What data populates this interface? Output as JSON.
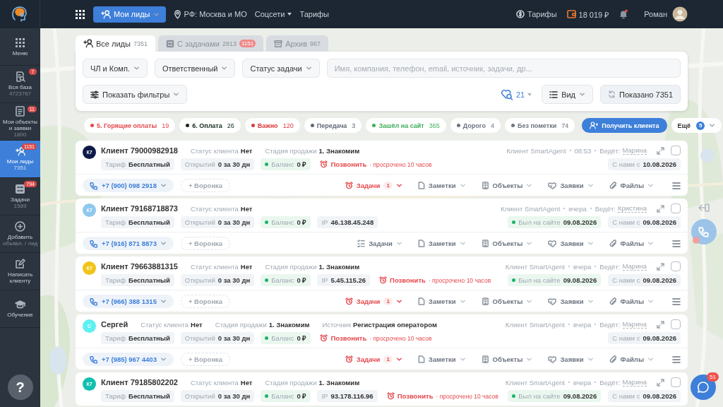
{
  "topbar": {
    "menu_button": {
      "label": "Мои лиды"
    },
    "region": "РФ: Москва и МО",
    "links": [
      {
        "label": "Соцсети",
        "dropdown": true
      },
      {
        "label": "Тарифы",
        "dropdown": false
      }
    ],
    "tariffs": "Тарифы",
    "balance": "18 019 ₽",
    "notifications_unread": true,
    "user": "Роман"
  },
  "sidebar": {
    "items": [
      {
        "kind": "menu",
        "label": "Меню",
        "selected": false
      },
      {
        "kind": "base",
        "label": "Вся база",
        "count": "4723767",
        "badge": "7",
        "selected": false
      },
      {
        "kind": "objects",
        "label": "Мои объекты и заявки",
        "count": "1800",
        "badge": "11",
        "selected": false
      },
      {
        "kind": "leads",
        "label": "Мои лиды",
        "count": "7351",
        "badge": "1151",
        "selected": true
      },
      {
        "kind": "tasks",
        "label": "Задачи",
        "count": "1589",
        "badge": "794",
        "selected": false
      },
      {
        "kind": "add",
        "label": "Добавить",
        "count": "объявл. / лид",
        "selected": false
      },
      {
        "kind": "write",
        "label": "Написать клиенту",
        "selected": false
      },
      {
        "kind": "learn",
        "label": "Обучение",
        "selected": false
      }
    ],
    "help_button": {
      "label": "?"
    }
  },
  "tabs": [
    {
      "kind": "all",
      "label": "Все лиды",
      "count": "7351",
      "selected": true
    },
    {
      "kind": "tasks",
      "label": "С задачами",
      "count": "2813",
      "badge": "1151",
      "selected": false
    },
    {
      "kind": "archive",
      "label": "Архив",
      "count": "967",
      "selected": false
    }
  ],
  "filters": {
    "dropdowns": [
      "ЧЛ и Комп.",
      "Ответственный",
      "Статус задачи"
    ],
    "search": {
      "placeholder": "Имя, компания, телефон, email, источник, задачи, др..."
    },
    "show_filters": "Показать фильтры",
    "saved_searches": "21",
    "view": "Вид",
    "shown": "Показано 7351"
  },
  "chips": [
    {
      "label": "5. Горящие оплаты",
      "count": "19",
      "color": "#e5484d"
    },
    {
      "label": "6. Оплата",
      "count": "26",
      "color": "#12281b"
    },
    {
      "label": "Важно",
      "count": "120",
      "color": "#d93a3a"
    },
    {
      "label": "Передача",
      "count": "3",
      "color": "#5f6874"
    },
    {
      "label": "Зашёл на сайт",
      "count": "365",
      "color": "#3fae5a"
    },
    {
      "label": "Дорого",
      "count": "4",
      "color": "#6b7480"
    },
    {
      "label": "Без пометки",
      "count": "74",
      "color": "#6b7480"
    }
  ],
  "get_client": "Получить клиента",
  "more": {
    "label": "Ещё",
    "badge": "5"
  },
  "leads": [
    {
      "initials": "К7",
      "color": "#0b1a48",
      "name": "Клиент 79000982918",
      "fields": [
        {
          "label": "Статус клиента",
          "value": "Нет"
        },
        {
          "label": "Стадия продажи",
          "value": "1. Знакомим"
        }
      ],
      "pills": [
        {
          "kind": "plain",
          "label": "Тариф",
          "value": "Бесплатный"
        },
        {
          "kind": "plain",
          "label": "Открытий",
          "value": "0 за 30 дн"
        },
        {
          "kind": "balance",
          "label": "Баланс",
          "value": "0 ₽"
        },
        {
          "kind": "task",
          "label": "Позвонить",
          "value": "· просрочено 10 часов"
        }
      ],
      "source": "Клиент SmartAgent",
      "time": "08:53",
      "manager_label": "Ведёт:",
      "manager": "Марина",
      "selected": false,
      "side_pills": [
        {
          "kind": "since",
          "label": "С нами с",
          "value": "10.08.2026"
        }
      ],
      "phone": "+7 (900) 098 2918",
      "funnel": "+ Воронка",
      "actions": [
        {
          "kind": "tasks",
          "label": "Задачи",
          "count": "1",
          "overdue": true
        },
        {
          "kind": "notes",
          "label": "Заметки"
        },
        {
          "kind": "objects",
          "label": "Объекты"
        },
        {
          "kind": "requests",
          "label": "Заявки"
        },
        {
          "kind": "files",
          "label": "Файлы"
        }
      ]
    },
    {
      "initials": "К7",
      "color": "#8fc8ee",
      "name": "Клиент 79168718873",
      "fields": [
        {
          "label": "Статус клиента",
          "value": "Нет"
        }
      ],
      "pills": [
        {
          "kind": "plain",
          "label": "Тариф",
          "value": "Бесплатный"
        },
        {
          "kind": "plain",
          "label": "Открытий",
          "value": "0 за 30 дн"
        },
        {
          "kind": "balance",
          "label": "Баланс",
          "value": "0 ₽"
        },
        {
          "kind": "plain",
          "label": "IP",
          "value": "46.138.45.248"
        }
      ],
      "source": "Клиент SmartAgent",
      "time": "вчера",
      "manager_label": "Ведёт:",
      "manager": "Кристина",
      "selected": false,
      "side_pills": [
        {
          "kind": "visit",
          "label": "Был на сайте",
          "value": "09.08.2026"
        },
        {
          "kind": "since",
          "label": "С нами с",
          "value": "09.08.2026"
        }
      ],
      "phone": "+7 (916) 871 8873",
      "funnel": "+ Воронка",
      "actions": [
        {
          "kind": "tasks",
          "label": "Задачи",
          "overdue": false
        },
        {
          "kind": "notes",
          "label": "Заметки"
        },
        {
          "kind": "objects",
          "label": "Объекты"
        },
        {
          "kind": "requests",
          "label": "Заявки"
        },
        {
          "kind": "files",
          "label": "Файлы"
        }
      ]
    },
    {
      "initials": "К7",
      "color": "#f0c419",
      "name": "Клиент 79663881315",
      "fields": [
        {
          "label": "Статус клиента",
          "value": "Нет"
        },
        {
          "label": "Стадия продажи",
          "value": "1. Знакомим"
        }
      ],
      "pills": [
        {
          "kind": "plain",
          "label": "Тариф",
          "value": "Бесплатный"
        },
        {
          "kind": "plain",
          "label": "Открытий",
          "value": "0 за 30 дн"
        },
        {
          "kind": "balance",
          "label": "Баланс",
          "value": "0 ₽"
        },
        {
          "kind": "plain",
          "label": "IP",
          "value": "5.45.115.26"
        },
        {
          "kind": "task",
          "label": "Позвонить",
          "value": "· просрочено 10 часов"
        }
      ],
      "source": "Клиент SmartAgent",
      "time": "вчера",
      "manager_label": "Ведёт:",
      "manager": "Марина",
      "selected": false,
      "side_pills": [
        {
          "kind": "visit",
          "label": "Был на сайте",
          "value": "09.08.2026"
        },
        {
          "kind": "since",
          "label": "С нами с",
          "value": "09.08.2026"
        }
      ],
      "phone": "+7 (966) 388 1315",
      "funnel": "+ Воронка",
      "actions": [
        {
          "kind": "tasks",
          "label": "Задачи",
          "count": "1",
          "overdue": true
        },
        {
          "kind": "notes",
          "label": "Заметки"
        },
        {
          "kind": "objects",
          "label": "Объекты"
        },
        {
          "kind": "requests",
          "label": "Заявки"
        },
        {
          "kind": "files",
          "label": "Файлы"
        }
      ]
    },
    {
      "initials": "С",
      "color": "#5ff0f2",
      "name": "Сергей",
      "fields": [
        {
          "label": "Статус клиента",
          "value": "Нет"
        },
        {
          "label": "Стадия продажи",
          "value": "1. Знакомим"
        },
        {
          "label": "Источник",
          "value": "Регистрация оператором"
        }
      ],
      "pills": [
        {
          "kind": "plain",
          "label": "Тариф",
          "value": "Бесплатный"
        },
        {
          "kind": "plain",
          "label": "Открытий",
          "value": "0 за 30 дн"
        },
        {
          "kind": "balance",
          "label": "Баланс",
          "value": "0 ₽"
        },
        {
          "kind": "task",
          "label": "Позвонить",
          "value": "· просрочено 10 часов"
        }
      ],
      "source": "Клиент SmartAgent",
      "time": "вчера",
      "manager_label": "Ведёт:",
      "manager": "Марина",
      "selected": false,
      "side_pills": [
        {
          "kind": "since",
          "label": "С нами с",
          "value": "09.08.2026"
        }
      ],
      "phone": "+7 (985) 967 4403",
      "funnel": "+ Воронка",
      "actions": [
        {
          "kind": "tasks",
          "label": "Задачи",
          "count": "1",
          "overdue": true
        },
        {
          "kind": "notes",
          "label": "Заметки"
        },
        {
          "kind": "objects",
          "label": "Объекты"
        },
        {
          "kind": "requests",
          "label": "Заявки"
        },
        {
          "kind": "files",
          "label": "Файлы"
        }
      ]
    },
    {
      "initials": "К7",
      "color": "#12bfae",
      "name": "Клиент 79185802202",
      "fields": [
        {
          "label": "Статус клиента",
          "value": "Нет"
        },
        {
          "label": "Стадия продажи",
          "value": "1. Знакомим"
        }
      ],
      "pills": [
        {
          "kind": "plain",
          "label": "Тариф",
          "value": "Бесплатный"
        },
        {
          "kind": "plain",
          "label": "Открытий",
          "value": "0 за 30 дн"
        },
        {
          "kind": "balance",
          "label": "Баланс",
          "value": "0 ₽"
        },
        {
          "kind": "plain",
          "label": "IP",
          "value": "93.178.116.96"
        },
        {
          "kind": "task",
          "label": "Позвонить",
          "value": "· просрочено 10 часов"
        }
      ],
      "source": "Клиент SmartAgent",
      "time": "вчера",
      "manager_label": "Ведёт:",
      "manager": "Марина",
      "selected": false,
      "side_pills": [
        {
          "kind": "visit",
          "label": "Был на сайте",
          "value": "09.08.2026"
        },
        {
          "kind": "since",
          "label": "С нами с",
          "value": "09.08.2026"
        }
      ]
    }
  ],
  "call_widget": {
    "missed": true
  },
  "chat_button": {
    "badge": "51"
  }
}
